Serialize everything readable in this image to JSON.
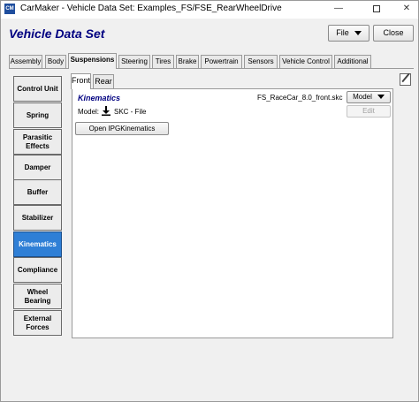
{
  "window": {
    "app_icon": "CM",
    "title": "CarMaker - Vehicle Data Set: Examples_FS/FSE_RearWheelDrive",
    "minimize_glyph": "—",
    "close_glyph": "✕"
  },
  "header": {
    "title": "Vehicle Data Set",
    "file_label": "File",
    "close_label": "Close"
  },
  "top_tabs": [
    "Assembly",
    "Body",
    "Suspensions",
    "Steering",
    "Tires",
    "Brake",
    "Powertrain",
    "Sensors",
    "Vehicle Control",
    "Additional"
  ],
  "active_top_tab": "Suspensions",
  "side_nav": [
    "Control Unit",
    "Spring",
    "Parasitic Effects",
    "Damper",
    "Buffer",
    "Stabilizer",
    "Kinematics",
    "Compliance",
    "Wheel Bearing",
    "External Forces"
  ],
  "active_side_nav": "Kinematics",
  "inner_tabs": [
    "Front",
    "Rear"
  ],
  "active_inner_tab": "Front",
  "kinematics": {
    "title": "Kinematics",
    "file_name": "FS_RaceCar_8.0_front.skc",
    "model_dropdown": "Model",
    "edit_label": "Edit",
    "model_label": "Model:",
    "model_value": "SKC - File",
    "open_button": "Open IPGKinematics"
  },
  "icons": {
    "notes": "notes-pencil-icon",
    "download": "download-icon",
    "dropdown": "triangle-down-icon"
  },
  "colors": {
    "accent_title": "#000080",
    "active_nav": "#2f7fd6"
  }
}
